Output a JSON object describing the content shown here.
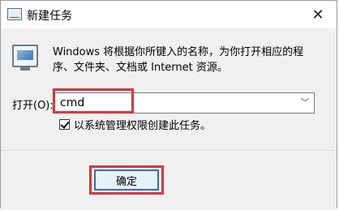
{
  "window": {
    "title": "新建任务",
    "close_glyph": "✕"
  },
  "content": {
    "description": "Windows 将根据你所键入的名称，为你打开相应的程序、文件夹、文档或 Internet 资源。",
    "open_label": "打开(O):",
    "open_value": "cmd",
    "admin_checkbox": {
      "label": "以系统管理权限创建此任务。",
      "checked": true
    }
  },
  "buttons": {
    "ok_label": "确定"
  },
  "colors": {
    "highlight": "#e0333a",
    "focus_border": "#2f6dc6"
  }
}
